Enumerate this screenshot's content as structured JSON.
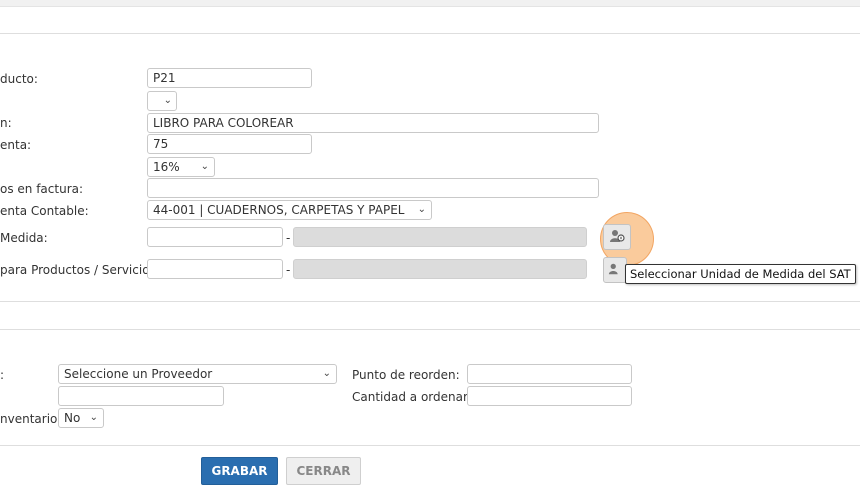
{
  "product": {
    "code_label": "ducto:",
    "code_value": "P21",
    "description_label": "n:",
    "description_value": "LIBRO PARA COLOREAR",
    "price_label": "enta:",
    "price_value": "75",
    "tax_value": "16%",
    "invoice_label": "os en factura:",
    "invoice_value": "",
    "account_label": "enta Contable:",
    "account_value": "44-001 | CUADERNOS, CARPETAS Y PAPEL",
    "unit_label": " Medida:",
    "unit_code_value": "",
    "unit_desc_value": "",
    "sat_label": "para Productos / Servicios:",
    "sat_code_value": "",
    "sat_desc_value": "",
    "dash": "-"
  },
  "tooltip": {
    "text": "Seleccionar Unidad de Medida del SAT"
  },
  "inventory": {
    "provider_label": ":",
    "provider_value": "Seleccione un Proveedor",
    "extra_value": "",
    "inventory_label": "nventario:",
    "inventory_value": "No",
    "reorder_label": "Punto de reorden:",
    "reorder_value": "",
    "quantity_label": "Cantidad a ordenar:",
    "quantity_value": ""
  },
  "actions": {
    "save_label": "GRABAR",
    "close_label": "CERRAR"
  },
  "colors": {
    "primary": "#2a6eb0",
    "highlight": "#f6a04a"
  }
}
